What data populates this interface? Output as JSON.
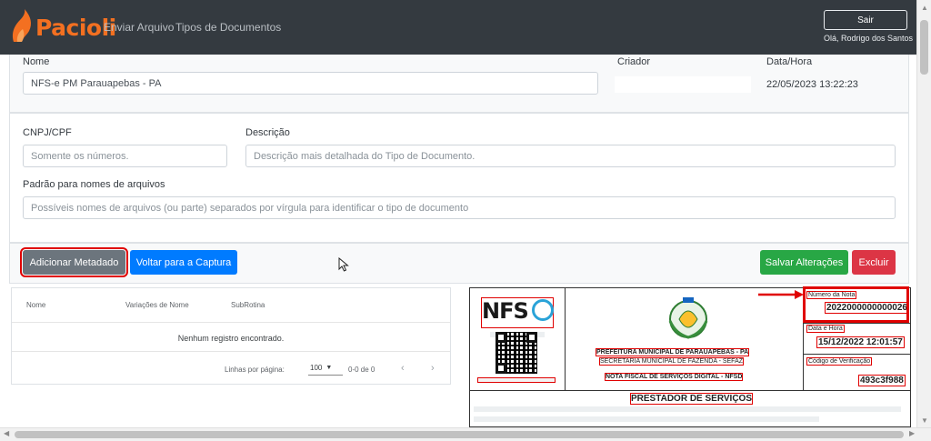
{
  "nav": {
    "brand": "Pacioli",
    "links": [
      "Enviar Arquivo",
      "Tipos de Documentos"
    ],
    "logout_label": "Sair",
    "greeting": "Olá, Rodrigo dos Santos"
  },
  "form": {
    "nome_label": "Nome",
    "nome_value": "NFS-e PM Parauapebas - PA",
    "criador_label": "Criador",
    "datahora_label": "Data/Hora",
    "datahora_value": "22/05/2023 13:22:23",
    "cnpj_label": "CNPJ/CPF",
    "cnpj_placeholder": "Somente os números.",
    "descricao_label": "Descrição",
    "descricao_placeholder": "Descrição mais detalhada do Tipo de Documento.",
    "padrao_label": "Padrão para nomes de arquivos",
    "padrao_placeholder": "Possíveis nomes de arquivos (ou parte) separados por vírgula para identificar o tipo de documento"
  },
  "actions": {
    "add_metadata": "Adicionar Metadado",
    "back_capture": "Voltar para a Captura",
    "save": "Salvar Alterações",
    "delete": "Excluir"
  },
  "table": {
    "columns": [
      "Nome",
      "Variações de Nome",
      "SubRotina"
    ],
    "empty_message": "Nenhum registro encontrado.",
    "rows_per_page_label": "Linhas por página:",
    "rows_per_page_value": "100",
    "range": "0-0 de 0"
  },
  "document": {
    "logo_text": "NFS",
    "municipality": "PREFEITURA MUNICIPAL DE PARAUAPEBAS - PA",
    "secretariat": "SECRETARIA MUNICIPAL DE FAZENDA - SEFAZ",
    "doc_title": "NOTA FISCAL DE SERVIÇOS DIGITAL - NFSD",
    "numero_label": "Número da Nota",
    "numero_value": "2022000000000026",
    "data_label": "Data e Hora",
    "data_value": "15/12/2022 12:01:57",
    "codigo_label": "Código de Verificação",
    "codigo_value": "493c3f988",
    "prestador_title": "PRESTADOR DE SERVIÇOS"
  },
  "colors": {
    "navbar": "#343a40",
    "brand": "#f37021",
    "primary": "#007bff",
    "secondary": "#6c757d",
    "success": "#28a745",
    "danger": "#dc3545",
    "annotation": "#e00000"
  }
}
